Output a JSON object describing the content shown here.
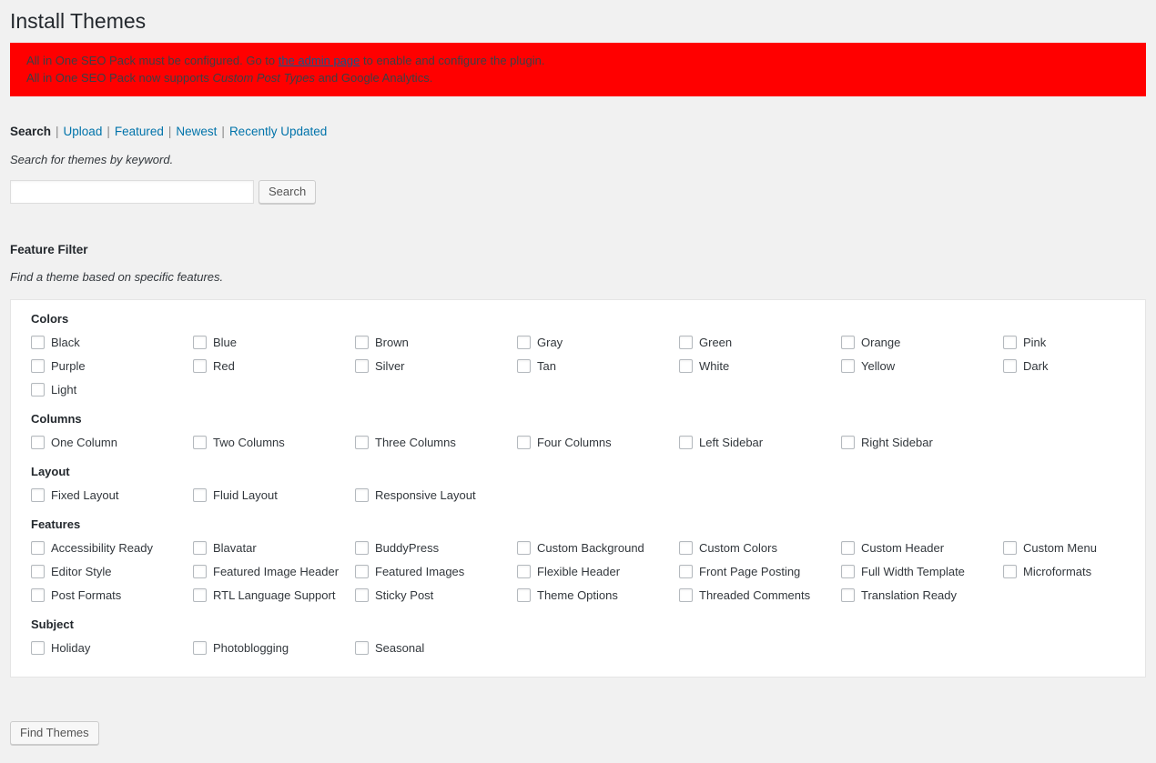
{
  "page_title": "Install Themes",
  "notice": {
    "line1_before": "All in One SEO Pack must be configured. Go to ",
    "line1_link": "the admin page",
    "line1_after": " to enable and configure the plugin.",
    "line2_before": "All in One SEO Pack now supports ",
    "line2_em": "Custom Post Types",
    "line2_after": " and Google Analytics.",
    "background_color": "#ff0000",
    "text_color": "#3b4045",
    "link_color": "#0b5a8e"
  },
  "tabs": [
    {
      "label": "Search",
      "current": true
    },
    {
      "label": "Upload",
      "current": false
    },
    {
      "label": "Featured",
      "current": false
    },
    {
      "label": "Newest",
      "current": false
    },
    {
      "label": "Recently Updated",
      "current": false
    }
  ],
  "tab_separator": "|",
  "search": {
    "description": "Search for themes by keyword.",
    "value": "",
    "placeholder": "",
    "button_label": "Search"
  },
  "feature_filter": {
    "title": "Feature Filter",
    "description": "Find a theme based on specific features.",
    "groups": [
      {
        "title": "Colors",
        "options": [
          "Black",
          "Blue",
          "Brown",
          "Gray",
          "Green",
          "Orange",
          "Pink",
          "Purple",
          "Red",
          "Silver",
          "Tan",
          "White",
          "Yellow",
          "Dark",
          "Light"
        ]
      },
      {
        "title": "Columns",
        "options": [
          "One Column",
          "Two Columns",
          "Three Columns",
          "Four Columns",
          "Left Sidebar",
          "Right Sidebar"
        ]
      },
      {
        "title": "Layout",
        "options": [
          "Fixed Layout",
          "Fluid Layout",
          "Responsive Layout"
        ]
      },
      {
        "title": "Features",
        "options": [
          "Accessibility Ready",
          "Blavatar",
          "BuddyPress",
          "Custom Background",
          "Custom Colors",
          "Custom Header",
          "Custom Menu",
          "Editor Style",
          "Featured Image Header",
          "Featured Images",
          "Flexible Header",
          "Front Page Posting",
          "Full Width Template",
          "Microformats",
          "Post Formats",
          "RTL Language Support",
          "Sticky Post",
          "Theme Options",
          "Threaded Comments",
          "Translation Ready"
        ]
      },
      {
        "title": "Subject",
        "options": [
          "Holiday",
          "Photoblogging",
          "Seasonal"
        ]
      }
    ]
  },
  "find_themes_button": "Find Themes"
}
